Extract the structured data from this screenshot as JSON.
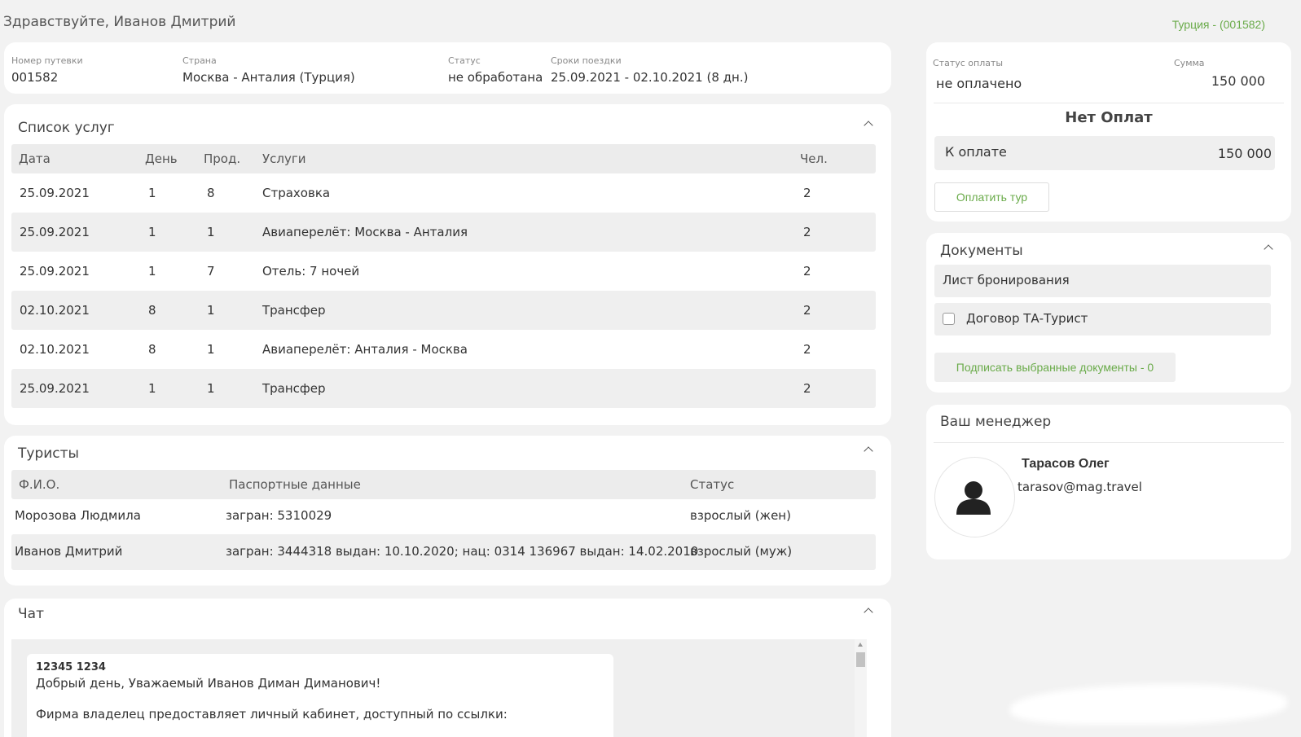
{
  "header": {
    "greeting": "Здравствуйте, Иванов Дмитрий",
    "tour_ref": "Турция - (001582)"
  },
  "info": {
    "voucher_label": "Номер путевки",
    "voucher_value": "001582",
    "country_label": "Страна",
    "country_value": "Москва - Анталия (Турция)",
    "status_label": "Статус",
    "status_value": "не обработана",
    "dates_label": "Сроки поездки",
    "dates_value": "25.09.2021 - 02.10.2021 (8 дн.)"
  },
  "services": {
    "title": "Список услуг",
    "columns": [
      "Дата",
      "День",
      "Прод.",
      "Услуги",
      "Чел."
    ],
    "rows": [
      [
        "25.09.2021",
        "1",
        "8",
        "Страховка",
        "2"
      ],
      [
        "25.09.2021",
        "1",
        "1",
        "Авиаперелёт: Москва - Анталия",
        "2"
      ],
      [
        "25.09.2021",
        "1",
        "7",
        "Отель: 7 ночей",
        "2"
      ],
      [
        "02.10.2021",
        "8",
        "1",
        "Трансфер",
        "2"
      ],
      [
        "02.10.2021",
        "8",
        "1",
        "Авиаперелёт: Анталия - Москва",
        "2"
      ],
      [
        "25.09.2021",
        "1",
        "1",
        "Трансфер",
        "2"
      ]
    ]
  },
  "tourists": {
    "title": "Туристы",
    "columns": [
      "Ф.И.О.",
      "Паспортные данные",
      "Статус"
    ],
    "rows": [
      [
        "Морозова Людмила",
        "загран: 5310029",
        "взрослый (жен)"
      ],
      [
        "Иванов Дмитрий",
        "загран: 3444318 выдан: 10.10.2020; нац: 0314 136967 выдан: 14.02.2010",
        "взрослый (муж)"
      ]
    ]
  },
  "chat": {
    "title": "Чат",
    "author": "12345 1234",
    "line1": "Добрый день, Уважаемый Иванов Диман Диманович!",
    "line2": "Фирма владелец предоставляет личный кабинет, доступный по ссылки:"
  },
  "payment": {
    "status_label": "Статус оплаты",
    "status_value": "не оплачено",
    "sum_label": "Сумма",
    "sum_value": "150 000",
    "no_payments": "Нет Оплат",
    "to_pay_label": "К оплате",
    "to_pay_value": "150 000",
    "pay_button": "Оплатить тур"
  },
  "documents": {
    "title": "Документы",
    "item1": "Лист бронирования",
    "item2": "Договор ТА-Турист",
    "sign_button": "Подписать выбранные документы - 0"
  },
  "manager": {
    "title": "Ваш менеджер",
    "name": "Тарасов Олег",
    "email": "tarasov@mag.travel"
  },
  "icons": {
    "collapse": "chevron-up-icon",
    "avatar": "user-silhouette-icon",
    "checkbox": "checkbox-icon"
  },
  "colors": {
    "accent_green": "#6aab4a",
    "background": "#f2f2f2"
  }
}
